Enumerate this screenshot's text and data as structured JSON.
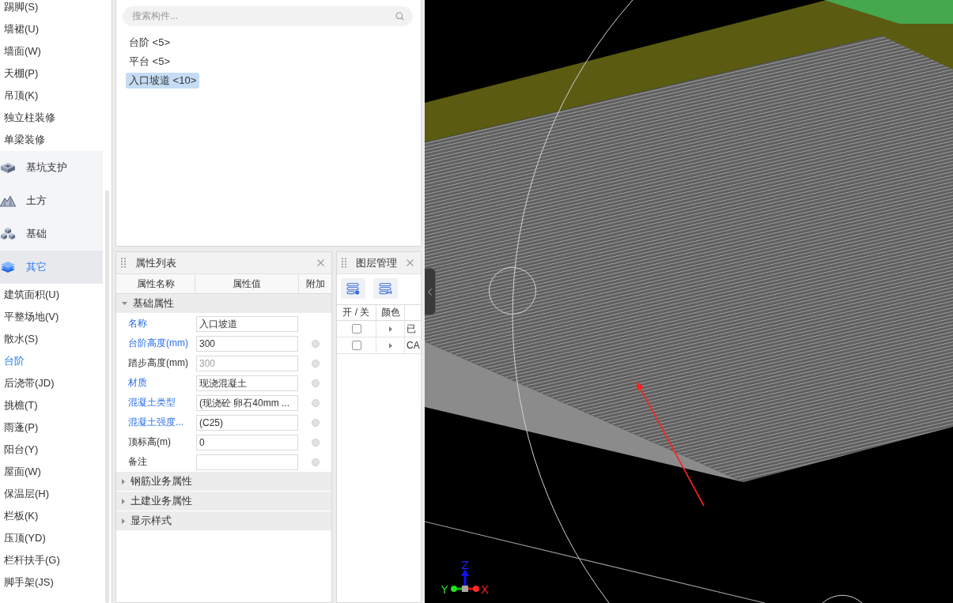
{
  "sidebar": {
    "items": [
      {
        "kind": "item",
        "label": "踢脚(S)",
        "selected": false
      },
      {
        "kind": "item",
        "label": "墙裙(U)",
        "selected": false
      },
      {
        "kind": "item",
        "label": "墙面(W)",
        "selected": false
      },
      {
        "kind": "item",
        "label": "天棚(P)",
        "selected": false
      },
      {
        "kind": "item",
        "label": "吊顶(K)",
        "selected": false
      },
      {
        "kind": "item",
        "label": "独立柱装修",
        "selected": false
      },
      {
        "kind": "item",
        "label": "单梁装修",
        "selected": false
      },
      {
        "kind": "category",
        "label": "基坑支护",
        "selected": false
      },
      {
        "kind": "category",
        "label": "土方",
        "selected": false
      },
      {
        "kind": "category",
        "label": "基础",
        "selected": false
      },
      {
        "kind": "category",
        "label": "其它",
        "selected": true,
        "children": [
          {
            "kind": "item",
            "label": "建筑面积(U)",
            "selected": false
          },
          {
            "kind": "item",
            "label": "平整场地(V)",
            "selected": false
          },
          {
            "kind": "item",
            "label": "散水(S)",
            "selected": false
          },
          {
            "kind": "item",
            "label": "台阶",
            "selected": true
          },
          {
            "kind": "item",
            "label": "后浇带(JD)",
            "selected": false
          },
          {
            "kind": "item",
            "label": "挑檐(T)",
            "selected": false
          },
          {
            "kind": "item",
            "label": "雨蓬(P)",
            "selected": false
          },
          {
            "kind": "item",
            "label": "阳台(Y)",
            "selected": false
          },
          {
            "kind": "item",
            "label": "屋面(W)",
            "selected": false
          },
          {
            "kind": "item",
            "label": "保温层(H)",
            "selected": false
          },
          {
            "kind": "item",
            "label": "栏板(K)",
            "selected": false
          },
          {
            "kind": "item",
            "label": "压顶(YD)",
            "selected": false
          },
          {
            "kind": "item",
            "label": "栏杆扶手(G)",
            "selected": false
          },
          {
            "kind": "item",
            "label": "脚手架(JS)",
            "selected": false
          }
        ]
      }
    ]
  },
  "component_panel": {
    "search": {
      "placeholder": "搜索构件..."
    },
    "items": [
      {
        "label": "台阶 <5>",
        "selected": false
      },
      {
        "label": "平台 <5>",
        "selected": false
      },
      {
        "label": "入口坡道 <10>",
        "selected": true
      }
    ]
  },
  "properties": {
    "title": "属性列表",
    "columns": [
      "属性名称",
      "属性值",
      "附加"
    ],
    "groups": [
      {
        "label": "基础属性",
        "expanded": true,
        "rows": [
          {
            "name": "名称",
            "value": "入口坡道",
            "public": true,
            "disabled": false
          },
          {
            "name": "台阶高度(mm)",
            "value": "300",
            "public": true,
            "disabled": false,
            "attached": false
          },
          {
            "name": "踏步高度(mm)",
            "value": "300",
            "public": false,
            "disabled": true,
            "attached": false
          },
          {
            "name": "材质",
            "value": "现浇混凝土",
            "public": true,
            "disabled": false,
            "attached": false
          },
          {
            "name": "混凝土类型",
            "value": "(现浇砼 卵石40mm ...",
            "public": true,
            "disabled": false,
            "attached": false
          },
          {
            "name": "混凝土强度...",
            "value": "(C25)",
            "public": true,
            "disabled": false,
            "attached": false
          },
          {
            "name": "顶标高(m)",
            "value": "0",
            "public": false,
            "disabled": false,
            "attached": false
          },
          {
            "name": "备注",
            "value": "",
            "public": false,
            "disabled": false,
            "attached": false
          }
        ]
      },
      {
        "label": "钢筋业务属性",
        "expanded": false
      },
      {
        "label": "土建业务属性",
        "expanded": false
      },
      {
        "label": "显示样式",
        "expanded": false
      }
    ]
  },
  "layers": {
    "title": "图层管理",
    "columns": [
      "开 / 关",
      "颜色"
    ],
    "rows": [
      {
        "checked": false,
        "label": "已"
      },
      {
        "checked": false,
        "label": "CA"
      }
    ]
  },
  "viewport": {
    "axis_labels": {
      "x": "X",
      "y": "Y",
      "z": "Z"
    }
  }
}
